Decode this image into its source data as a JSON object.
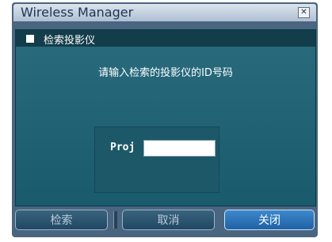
{
  "window": {
    "title": "Wireless Manager",
    "close_glyph": "✕"
  },
  "section": {
    "title": "检索投影仪"
  },
  "instruction": "请输入检索的投影仪的ID号码",
  "input": {
    "label": "Proj",
    "value": "",
    "placeholder": ""
  },
  "buttons": {
    "search": "检索",
    "cancel": "取消",
    "close": "关闭"
  },
  "colors": {
    "accent": "#2a6fb6",
    "panel": "#1d5868",
    "background": "#4a6580"
  }
}
